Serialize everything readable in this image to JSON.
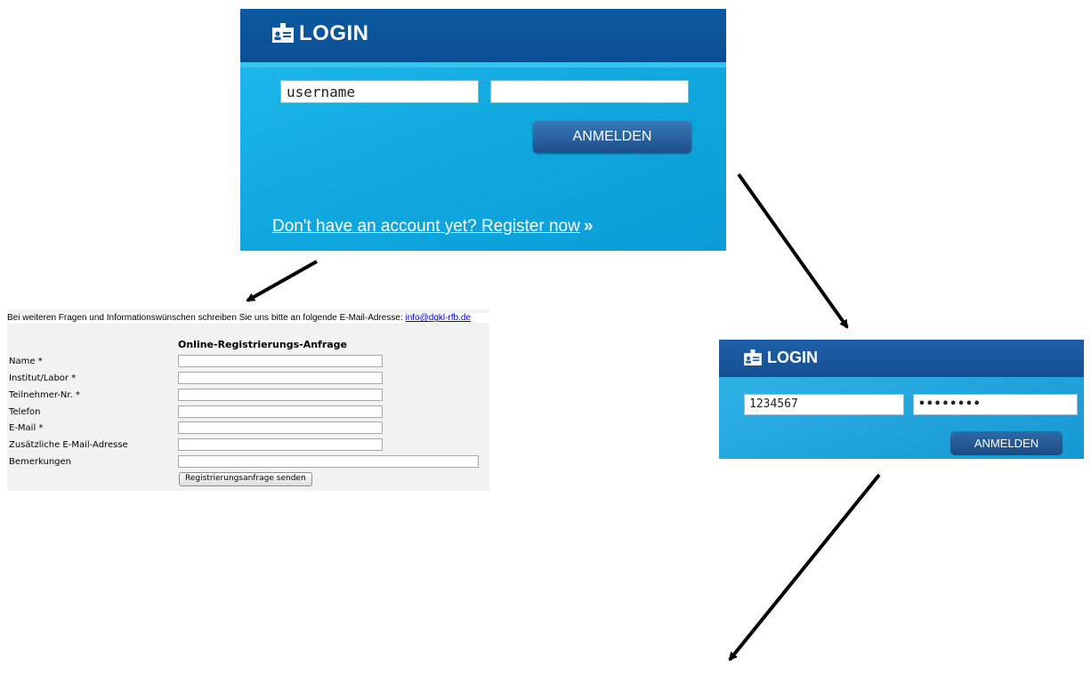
{
  "login_large": {
    "title": "LOGIN",
    "username_value": "username",
    "password_value": "",
    "submit_label": "ANMELDEN",
    "register_link": "Don't have an account yet? Register now",
    "register_suffix": "»"
  },
  "login_small": {
    "title": "LOGIN",
    "username_value": "1234567",
    "password_value": "••••••••",
    "submit_label": "ANMELDEN"
  },
  "registration": {
    "info_text": "Bei weiteren Fragen und Informationswünschen schreiben Sie uns bitte an folgende E-Mail-Adresse: ",
    "info_email": "info@dgkl-rfb.de",
    "form_title": "Online-Registrierungs-Anfrage",
    "fields": [
      {
        "label": "Name *"
      },
      {
        "label": "Institut/Labor *"
      },
      {
        "label": "Teilnehmer-Nr. *"
      },
      {
        "label": "Telefon"
      },
      {
        "label": "E-Mail *"
      },
      {
        "label": "Zusätzliche E-Mail-Adresse"
      },
      {
        "label": "Bemerkungen"
      }
    ],
    "submit_label": "Registrierungsanfrage senden"
  },
  "icons": {
    "login_icon": "id-card-icon",
    "arrow": "arrow-icon"
  },
  "colors": {
    "panel_blue": "#0aa6dc",
    "header_blue": "#0d5aa0",
    "button_blue": "#1d4e8a",
    "link_blue": "#0000cc"
  }
}
